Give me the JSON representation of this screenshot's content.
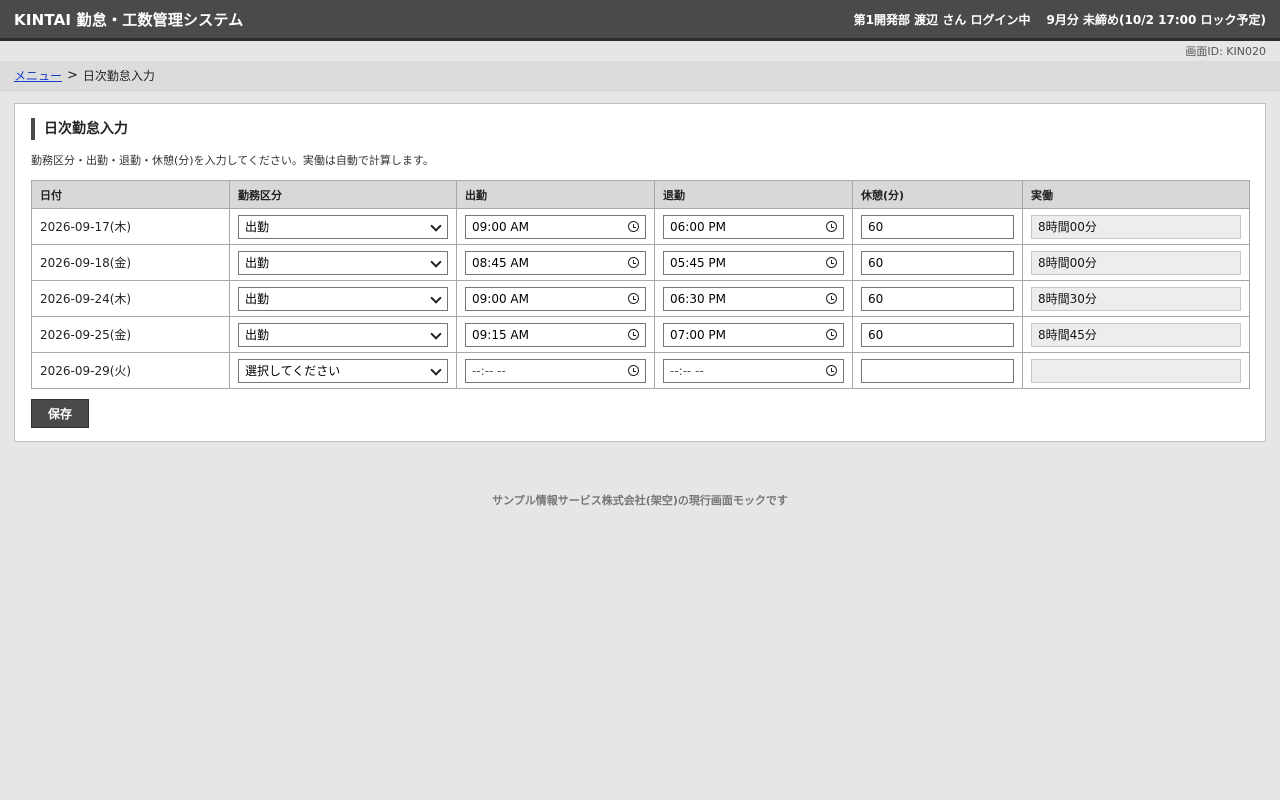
{
  "header": {
    "app_title": "KINTAI 勤怠・工数管理システム",
    "user_status": "第1開発部 渡辺 さん ログイン中",
    "period_status": "9月分 未締め(10/2 17:00 ロック予定)"
  },
  "screen_id": "画面ID: KIN020",
  "breadcrumb": {
    "menu_link": "メニュー",
    "separator": ">",
    "current": "日次勤怠入力"
  },
  "panel": {
    "title": "日次勤怠入力",
    "description": "勤務区分・出勤・退勤・休憩(分)を入力してください。実働は自動で計算します。"
  },
  "table": {
    "headers": [
      "日付",
      "勤務区分",
      "出勤",
      "退勤",
      "休憩(分)",
      "実働"
    ],
    "rows": [
      {
        "date": "2026-09-17(木)",
        "work_type": "出勤",
        "clock_in": "09:00 AM",
        "clock_out": "06:00 PM",
        "break": "60",
        "actual": "8時間00分"
      },
      {
        "date": "2026-09-18(金)",
        "work_type": "出勤",
        "clock_in": "08:45 AM",
        "clock_out": "05:45 PM",
        "break": "60",
        "actual": "8時間00分"
      },
      {
        "date": "2026-09-24(木)",
        "work_type": "出勤",
        "clock_in": "09:00 AM",
        "clock_out": "06:30 PM",
        "break": "60",
        "actual": "8時間30分"
      },
      {
        "date": "2026-09-25(金)",
        "work_type": "出勤",
        "clock_in": "09:15 AM",
        "clock_out": "07:00 PM",
        "break": "60",
        "actual": "8時間45分"
      },
      {
        "date": "2026-09-29(火)",
        "work_type": "選択してください",
        "clock_in": "--:-- --",
        "clock_out": "--:-- --",
        "break": "",
        "actual": ""
      }
    ]
  },
  "save_button": "保存",
  "footer": "サンプル情報サービス株式会社(架空)の現行画面モックです",
  "icons": {
    "select": "chevron-down-icon",
    "time": "clock-icon"
  }
}
